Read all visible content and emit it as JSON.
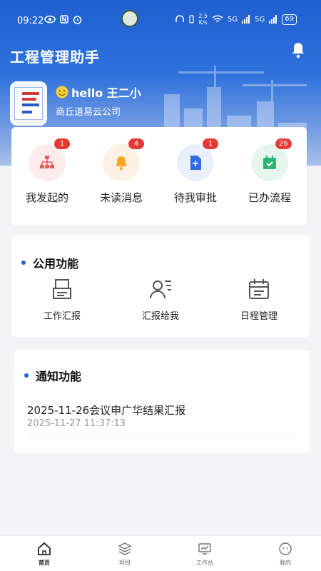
{
  "status_bar": {
    "time": "09:22",
    "left_icons": [
      "eye-icon",
      "nfc-icon",
      "alarm-icon"
    ],
    "speed": "2.5",
    "speed_unit": "K/s",
    "network_1": "5G",
    "network_2": "5G",
    "battery": "69"
  },
  "header": {
    "title": "工程管理助手",
    "greeting": "hello  王二小",
    "company": "商丘道易云公司"
  },
  "quick_actions": [
    {
      "label": "我发起的",
      "badge": "1",
      "icon": "org-chart-icon",
      "color": "#ef5a5a",
      "bg": "#fdecec"
    },
    {
      "label": "未读消息",
      "badge": "4",
      "icon": "bell-icon",
      "color": "#f5a623",
      "bg": "#fdf1e6"
    },
    {
      "label": "待我审批",
      "badge": "1",
      "icon": "add-document-icon",
      "color": "#2d6be0",
      "bg": "#e9f0fc"
    },
    {
      "label": "已办流程",
      "badge": "26",
      "icon": "calendar-check-icon",
      "color": "#2bb673",
      "bg": "#e6f6ee"
    }
  ],
  "public_functions": {
    "title": "公用功能",
    "items": [
      {
        "label": "工作汇报",
        "icon": "printer-report-icon"
      },
      {
        "label": "汇报给我",
        "icon": "user-list-icon"
      },
      {
        "label": "日程管理",
        "icon": "calendar-icon"
      }
    ]
  },
  "notifications": {
    "title": "通知功能",
    "items": [
      {
        "title": "2025-11-26会议申广华结果汇报",
        "time": "2025-11-27 11:37:13"
      }
    ]
  },
  "tabbar": [
    {
      "label": "首页",
      "icon": "home-icon",
      "active": true
    },
    {
      "label": "项目",
      "icon": "layers-icon",
      "active": false
    },
    {
      "label": "工作台",
      "icon": "monitor-icon",
      "active": false
    },
    {
      "label": "我的",
      "icon": "smile-face-icon",
      "active": false
    }
  ],
  "colors": {
    "brand": "#1f5fd0",
    "badge": "#e53935"
  }
}
